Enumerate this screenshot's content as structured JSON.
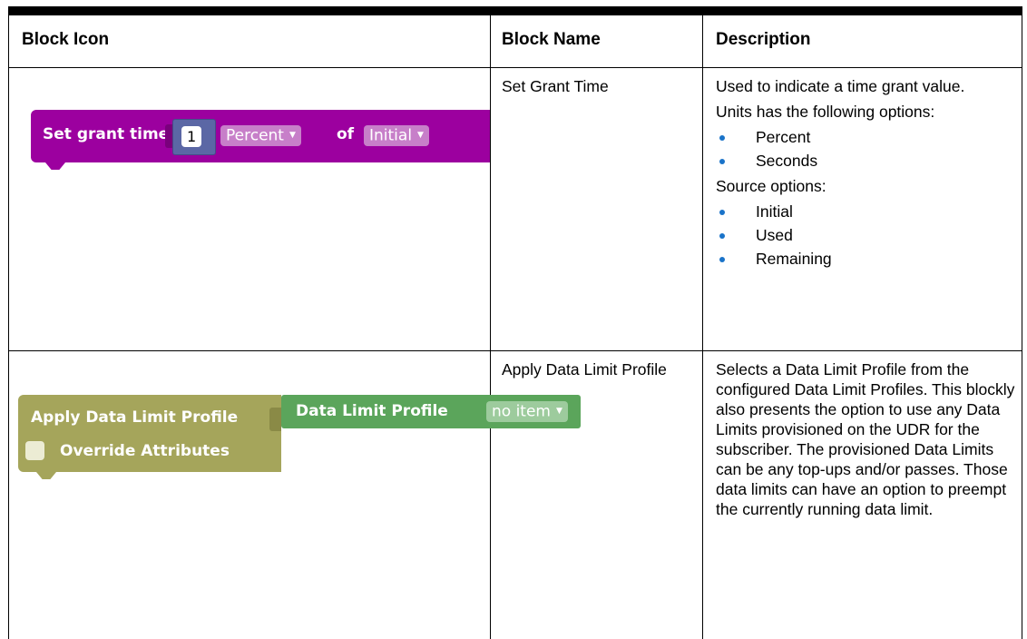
{
  "table": {
    "headers": {
      "icon": "Block Icon",
      "name": "Block Name",
      "description": "Description"
    },
    "rows": [
      {
        "name": "Set Grant Time",
        "block": {
          "label": "Set grant time",
          "number": "1",
          "unit": "Percent",
          "of": "of",
          "source": "Initial"
        },
        "description": {
          "intro": "Used to indicate a time grant value.",
          "units_heading": "Units has the following options:",
          "units": [
            "Percent",
            "Seconds"
          ],
          "source_heading": "Source options:",
          "sources": [
            "Initial",
            "Used",
            "Remaining"
          ]
        }
      },
      {
        "name": "Apply Data Limit Profile",
        "block": {
          "label": "Apply Data Limit Profile",
          "inner_label": "Data Limit Profile",
          "dropdown": "no item",
          "checkbox_label": "Override Attributes"
        },
        "description": {
          "text": "Selects a Data Limit Profile from the configured Data Limit Profiles. This blockly also presents the option to use any Data Limits provisioned on the UDR for the subscriber. The provisioned Data Limits can be any top-ups and/or passes. Those data limits can have an option to preempt the currently running data limit."
        }
      }
    ]
  },
  "colors": {
    "purple_block": "#9c009f",
    "olive_block": "#a5a55b",
    "green_block": "#5ba55b",
    "number_block": "#5b67a5",
    "bullet": "#1a73c9"
  }
}
